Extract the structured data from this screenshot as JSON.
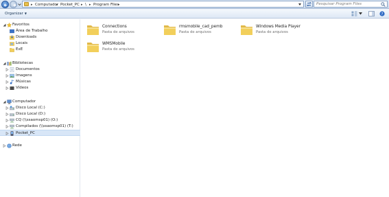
{
  "address": {
    "breadcrumbs": [
      "Computador",
      "Pocket_PC",
      "\\",
      "Program Files"
    ]
  },
  "search": {
    "placeholder": "Pesquisar Program Files"
  },
  "toolbar": {
    "organize_label": "Organizar"
  },
  "nav": {
    "favorites": {
      "label": "Favoritos",
      "items": [
        "Área de Trabalho",
        "Downloads",
        "Locais",
        "ExE"
      ]
    },
    "libraries": {
      "label": "Bibliotecas",
      "items": [
        "Documentos",
        "Imagens",
        "Músicas",
        "Vídeos"
      ]
    },
    "computer": {
      "label": "Computador",
      "items": [
        "Disco Local (C:)",
        "Disco Local (D:)",
        "CQ (\\\\ssaomsp01) (O:)",
        "Compilados (\\\\ssaomsp01) (T:)",
        "Pocket_PC"
      ]
    },
    "network": {
      "label": "Rede"
    }
  },
  "files": [
    {
      "name": "Connections",
      "type": "Pasta de arquivos"
    },
    {
      "name": "rmsmobile_cad_pemb",
      "type": "Pasta de arquivos"
    },
    {
      "name": "Windows Media Player",
      "type": "Pasta de arquivos"
    },
    {
      "name": "WMSMobile",
      "type": "Pasta de arquivos"
    }
  ],
  "colors": {
    "folder_yellow": "#f2cf5b",
    "selection": "#d8e6f7",
    "chrome_blue": "#c9d9ee"
  }
}
